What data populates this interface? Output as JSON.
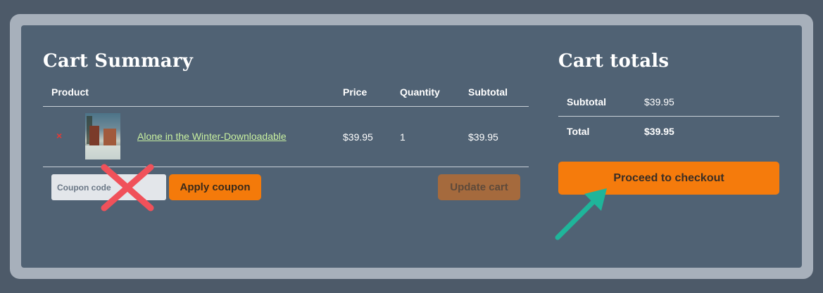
{
  "cart": {
    "title": "Cart Summary",
    "headers": {
      "product": "Product",
      "price": "Price",
      "quantity": "Quantity",
      "subtotal": "Subtotal"
    },
    "items": [
      {
        "remove": "×",
        "name": "Alone in the Winter-Downloadable",
        "price": "$39.95",
        "quantity": "1",
        "subtotal": "$39.95"
      }
    ],
    "coupon_placeholder": "Coupon code",
    "apply_label": "Apply coupon",
    "update_label": "Update cart"
  },
  "totals": {
    "title": "Cart totals",
    "subtotal_label": "Subtotal",
    "subtotal_value": "$39.95",
    "total_label": "Total",
    "total_value": "$39.95",
    "checkout_label": "Proceed to checkout"
  },
  "colors": {
    "accent": "#f57b0c",
    "panel": "#506274",
    "annotation_cross": "#f0515a",
    "annotation_arrow": "#1fb59a"
  }
}
